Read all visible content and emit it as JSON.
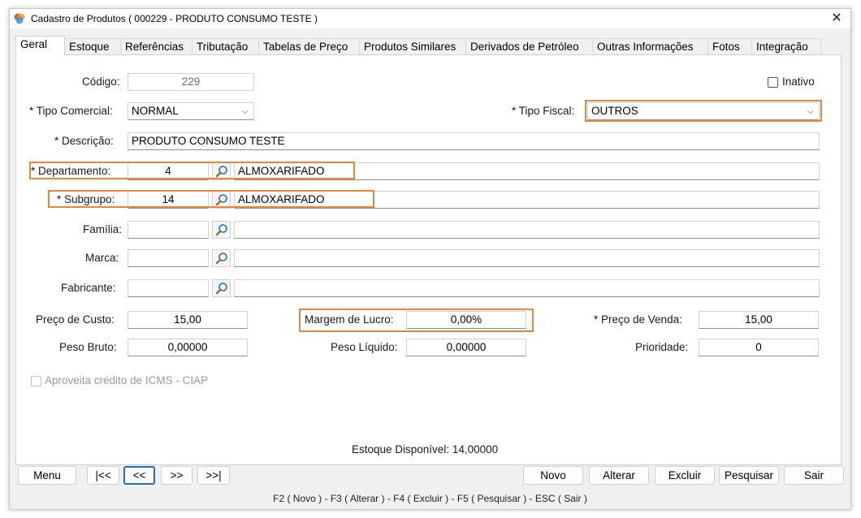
{
  "window": {
    "title": "Cadastro de Produtos ( 000229 - PRODUTO CONSUMO TESTE )",
    "close_glyph": "✕"
  },
  "tabs": [
    "Geral",
    "Estoque",
    "Referências",
    "Tributação",
    "Tabelas de Preço",
    "Produtos Similares",
    "Derivados de Petróleo",
    "Outras Informações",
    "Fotos",
    "Integração"
  ],
  "form": {
    "codigo_label": "Código:",
    "codigo_value": "229",
    "inativo_label": "Inativo",
    "tipo_comercial_label": "* Tipo Comercial:",
    "tipo_comercial_value": "NORMAL",
    "tipo_fiscal_label": "* Tipo Fiscal:",
    "tipo_fiscal_value": "OUTROS",
    "descricao_label": "* Descrição:",
    "descricao_value": "PRODUTO CONSUMO TESTE",
    "departamento_label": "* Departamento:",
    "departamento_code": "4",
    "departamento_name": "ALMOXARIFADO",
    "subgrupo_label": "* Subgrupo:",
    "subgrupo_code": "14",
    "subgrupo_name": "ALMOXARIFADO",
    "familia_label": "Família:",
    "familia_code": "",
    "familia_name": "",
    "marca_label": "Marca:",
    "marca_code": "",
    "marca_name": "",
    "fabricante_label": "Fabricante:",
    "fabricante_code": "",
    "fabricante_name": "",
    "preco_custo_label": "Preço de Custo:",
    "preco_custo_value": "15,00",
    "margem_lucro_label": "Margem de Lucro:",
    "margem_lucro_value": "0,00%",
    "preco_venda_label": "* Preço de Venda:",
    "preco_venda_value": "15,00",
    "peso_bruto_label": "Peso Bruto:",
    "peso_bruto_value": "0,00000",
    "peso_liquido_label": "Peso Líquido:",
    "peso_liquido_value": "0,00000",
    "prioridade_label": "Prioridade:",
    "prioridade_value": "0",
    "ciap_label": "Aproveita crédito de ICMS - CIAP",
    "estoque_disponivel": "Estoque Disponível: 14,00000"
  },
  "buttons": {
    "menu": "Menu",
    "first": "|<<",
    "prev": "<<",
    "next": ">>",
    "last": ">>|",
    "novo": "Novo",
    "alterar": "Alterar",
    "excluir": "Excluir",
    "pesquisar": "Pesquisar",
    "sair": "Sair"
  },
  "status": "F2 ( Novo )  -  F3 ( Alterar )  -  F4 ( Excluir )  -  F5 ( Pesquisar )  -  ESC ( Sair )",
  "icons": {
    "app": "app-logo-icon",
    "lookup": "magnifier-icon",
    "combo": "chevron-down-icon"
  },
  "colors": {
    "highlight": "#e8873a",
    "focus": "#1f6fc4"
  }
}
